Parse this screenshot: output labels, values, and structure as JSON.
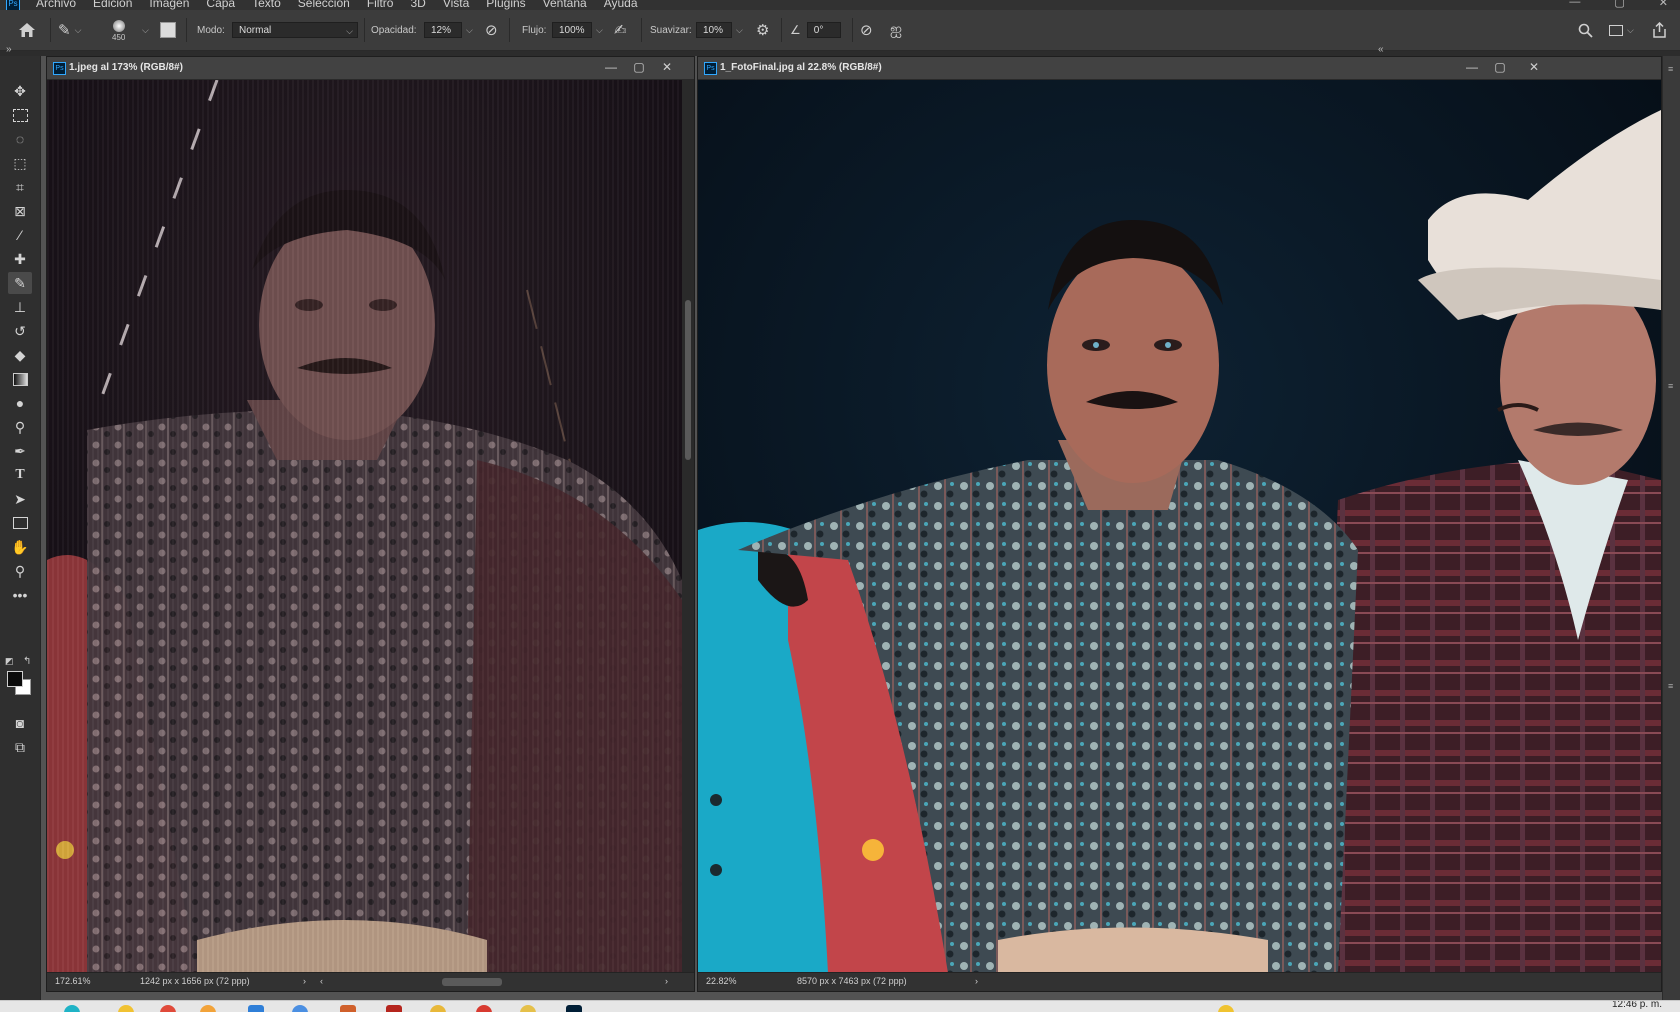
{
  "app": {
    "menus": [
      "Archivo",
      "Edición",
      "Imagen",
      "Capa",
      "Texto",
      "Selección",
      "Filtro",
      "3D",
      "Vista",
      "Plugins",
      "Ventana",
      "Ayuda"
    ]
  },
  "options": {
    "brush_size": "450",
    "mode_label": "Modo:",
    "mode_value": "Normal",
    "opacity_label": "Opacidad:",
    "opacity_value": "12%",
    "flow_label": "Flujo:",
    "flow_value": "100%",
    "smoothing_label": "Suavizar:",
    "smoothing_value": "10%",
    "angle_value": "0°"
  },
  "documents": [
    {
      "title": "1.jpeg al 173% (RGB/8#)",
      "zoom": "172.61%",
      "dimensions": "1242 px x 1656 px (72 ppp)"
    },
    {
      "title": "1_FotoFinal.jpg al 22.8% (RGB/8#)",
      "zoom": "22.82%",
      "dimensions": "8570 px x 7463 px (72 ppp)"
    }
  ],
  "taskbar": {
    "clock": "12:46 p. m."
  }
}
